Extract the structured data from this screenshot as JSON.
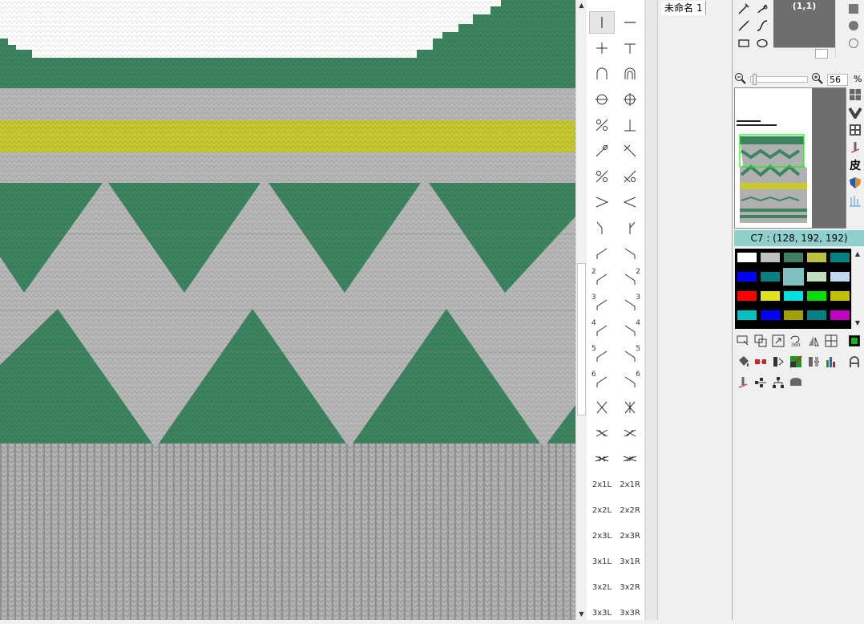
{
  "document": {
    "tab_label": "未命名 1"
  },
  "toolbar": {
    "zoom_value": "56",
    "zoom_unit": "%",
    "coordinate": "(1,1)",
    "leather_label": "皮"
  },
  "color": {
    "current": "C7 : (128, 192, 192)"
  },
  "stitch_labels": {
    "num2": "2",
    "num3": "3",
    "num4": "4",
    "num5": "5",
    "num6": "6",
    "c2x1l": "2x1L",
    "c2x1r": "2x1R",
    "c2x2l": "2x2L",
    "c2x2r": "2x2R",
    "c2x3l": "2x3L",
    "c2x3r": "2x3R",
    "c3x1l": "3x1L",
    "c3x1r": "3x1R",
    "c3x2l": "3x2L",
    "c3x2r": "3x2R",
    "c3x3l": "3x3L",
    "c3x3r": "3x3R"
  },
  "palette_colors": [
    [
      "#ffffff",
      "#c0c0c0",
      "#408060",
      "#c0c040",
      "#008080"
    ],
    [
      "#0000ff",
      "#008080",
      "#80c0c0",
      "#c0e0c0",
      "#c0d8f0"
    ],
    [
      "#ff0000",
      "#e0e020",
      "#00e0e0",
      "#00e000",
      "#c0c000"
    ],
    [
      "#00c0c0",
      "#0000ff",
      "#a0a000",
      "#008080",
      "#c000c0"
    ]
  ],
  "knit_colors": {
    "green": "#3d8560",
    "gray": "#b8b8b8",
    "yellow": "#c8c830",
    "rib": "#a4a4a4"
  }
}
